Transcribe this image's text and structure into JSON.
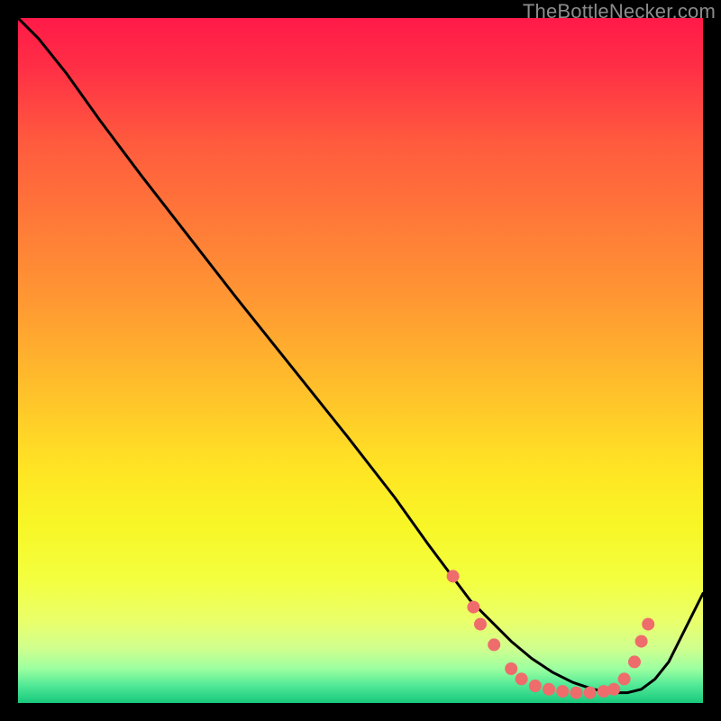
{
  "watermark": "TheBottleNecker.com",
  "chart_data": {
    "type": "line",
    "title": "",
    "xlabel": "",
    "ylabel": "",
    "xlim": [
      0,
      100
    ],
    "ylim": [
      0,
      100
    ],
    "grid": false,
    "legend": false,
    "background_gradient": {
      "stops": [
        {
          "offset": 0.0,
          "color": "#ff1a48"
        },
        {
          "offset": 0.07,
          "color": "#ff2e46"
        },
        {
          "offset": 0.18,
          "color": "#ff5a3e"
        },
        {
          "offset": 0.3,
          "color": "#ff7a38"
        },
        {
          "offset": 0.42,
          "color": "#ff9a32"
        },
        {
          "offset": 0.55,
          "color": "#ffc22a"
        },
        {
          "offset": 0.66,
          "color": "#ffe524"
        },
        {
          "offset": 0.74,
          "color": "#f8f626"
        },
        {
          "offset": 0.82,
          "color": "#f3ff3f"
        },
        {
          "offset": 0.88,
          "color": "#eaff6a"
        },
        {
          "offset": 0.92,
          "color": "#d0ff8e"
        },
        {
          "offset": 0.95,
          "color": "#9cffa0"
        },
        {
          "offset": 0.975,
          "color": "#4fe896"
        },
        {
          "offset": 1.0,
          "color": "#18c97c"
        }
      ]
    },
    "series": [
      {
        "name": "curve",
        "x": [
          0,
          3,
          7,
          12,
          18,
          25,
          32,
          40,
          48,
          55,
          60,
          63,
          66,
          69,
          72,
          75,
          78,
          81,
          84,
          87,
          89,
          91,
          93,
          95,
          97,
          100
        ],
        "y": [
          100,
          97,
          92,
          85,
          77,
          68,
          59,
          49,
          39,
          30,
          23,
          19,
          15,
          12,
          9,
          6.5,
          4.5,
          3,
          2,
          1.5,
          1.5,
          2,
          3.5,
          6,
          10,
          16
        ]
      }
    ],
    "markers": {
      "name": "dots",
      "color": "#ef6c6c",
      "radius": 7,
      "points": [
        {
          "x": 63.5,
          "y": 18.5
        },
        {
          "x": 66.5,
          "y": 14.0
        },
        {
          "x": 67.5,
          "y": 11.5
        },
        {
          "x": 69.5,
          "y": 8.5
        },
        {
          "x": 72.0,
          "y": 5.0
        },
        {
          "x": 73.5,
          "y": 3.5
        },
        {
          "x": 75.5,
          "y": 2.5
        },
        {
          "x": 77.5,
          "y": 2.0
        },
        {
          "x": 79.5,
          "y": 1.7
        },
        {
          "x": 81.5,
          "y": 1.5
        },
        {
          "x": 83.5,
          "y": 1.5
        },
        {
          "x": 85.5,
          "y": 1.7
        },
        {
          "x": 87.0,
          "y": 2.0
        },
        {
          "x": 88.5,
          "y": 3.5
        },
        {
          "x": 90.0,
          "y": 6.0
        },
        {
          "x": 91.0,
          "y": 9.0
        },
        {
          "x": 92.0,
          "y": 11.5
        }
      ]
    }
  }
}
